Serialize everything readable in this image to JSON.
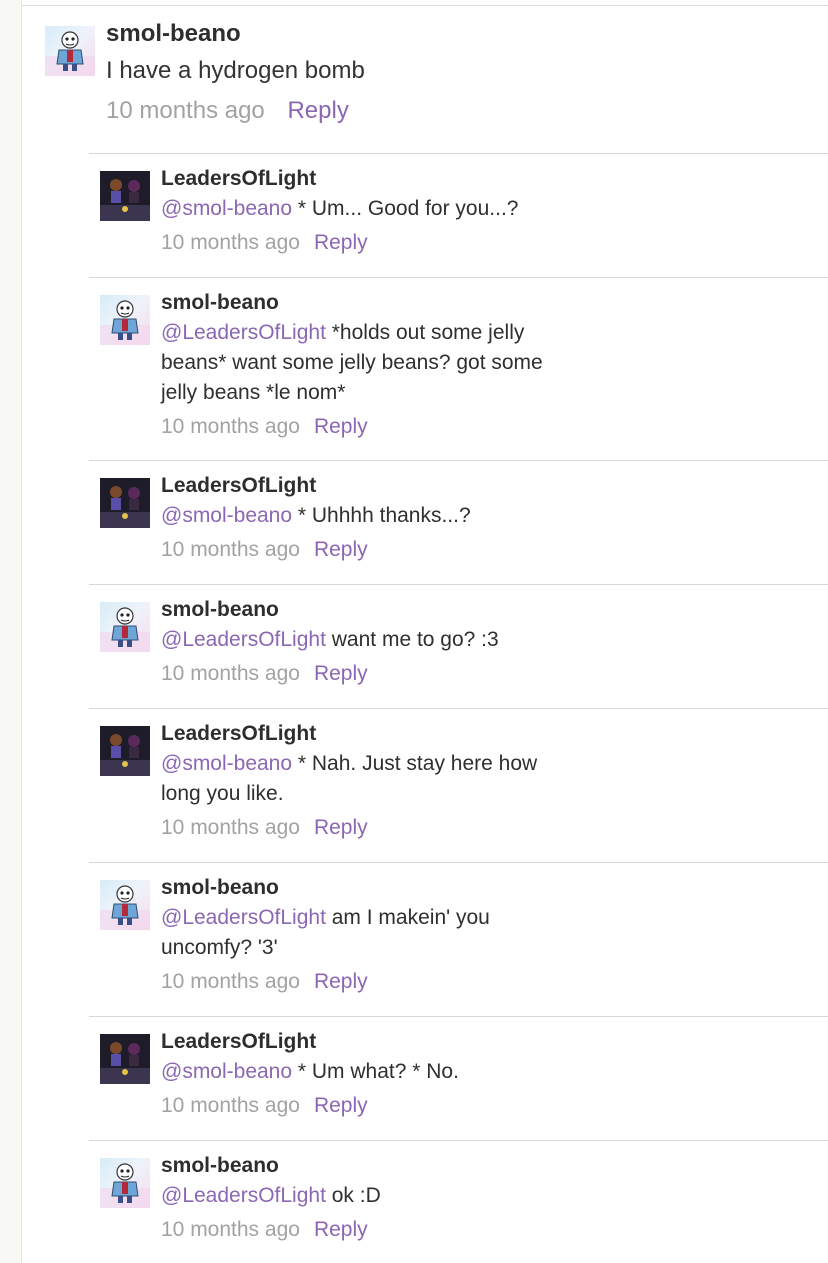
{
  "parent_comment": {
    "author": "smol-beano",
    "text": "I have a hydrogen bomb",
    "time": "10 months ago",
    "reply_label": "Reply",
    "avatar": "sans-skeleton-avatar"
  },
  "replies": [
    {
      "author": "LeadersOfLight",
      "mention": "@smol-beano",
      "text": " * Um... Good for you...?",
      "time": "10 months ago",
      "reply_label": "Reply",
      "avatar": "dark-duo-avatar"
    },
    {
      "author": "smol-beano",
      "mention": "@LeadersOfLight",
      "text": " *holds out some jelly beans* want some jelly beans? got some jelly beans *le nom*",
      "time": "10 months ago",
      "reply_label": "Reply",
      "avatar": "sans-skeleton-avatar"
    },
    {
      "author": "LeadersOfLight",
      "mention": "@smol-beano",
      "text": " * Uhhhh thanks...?",
      "time": "10 months ago",
      "reply_label": "Reply",
      "avatar": "dark-duo-avatar"
    },
    {
      "author": "smol-beano",
      "mention": "@LeadersOfLight",
      "text": " want me to go? :3",
      "time": "10 months ago",
      "reply_label": "Reply",
      "avatar": "sans-skeleton-avatar"
    },
    {
      "author": "LeadersOfLight",
      "mention": "@smol-beano",
      "text": " * Nah. Just stay here how long you like.",
      "time": "10 months ago",
      "reply_label": "Reply",
      "avatar": "dark-duo-avatar"
    },
    {
      "author": "smol-beano",
      "mention": "@LeadersOfLight",
      "text": " am I makein' you uncomfy? '3'",
      "time": "10 months ago",
      "reply_label": "Reply",
      "avatar": "sans-skeleton-avatar"
    },
    {
      "author": "LeadersOfLight",
      "mention": "@smol-beano",
      "text": " * Um what? * No.",
      "time": "10 months ago",
      "reply_label": "Reply",
      "avatar": "dark-duo-avatar"
    },
    {
      "author": "smol-beano",
      "mention": "@LeadersOfLight",
      "text": " ok :D",
      "time": "10 months ago",
      "reply_label": "Reply",
      "avatar": "sans-skeleton-avatar"
    }
  ],
  "colors": {
    "link_purple": "#8b67b3",
    "timestamp_gray": "#a2a2a2",
    "divider": "#d8d8d8"
  }
}
